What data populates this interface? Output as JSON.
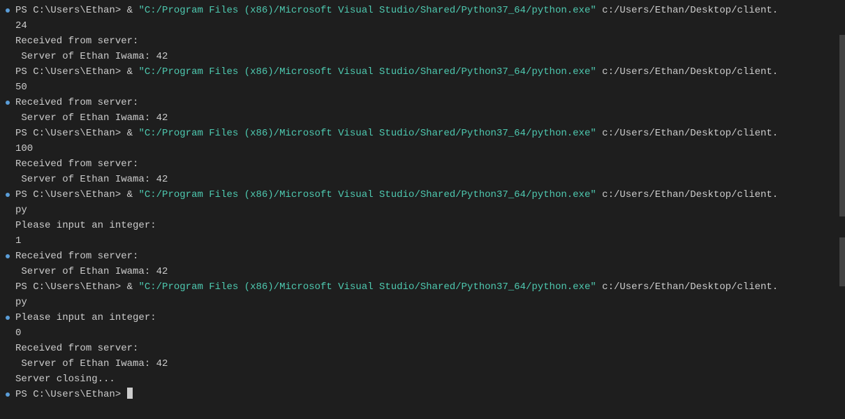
{
  "prompt": "PS C:\\Users\\Ethan>",
  "amp": "&",
  "exe_path": "\"C:/Program Files (x86)/Microsoft Visual Studio/Shared/Python37_64/python.exe\"",
  "client_path": "c:/Users/Ethan/Desktop/client.",
  "py_suffix": "py",
  "received": "Received from server:",
  "server_response": " Server of Ethan Iwama: 42",
  "input_prompt": "Please input an integer:",
  "server_closing": "Server closing...",
  "vals": {
    "v24": "24",
    "v50": "50",
    "v100": "100",
    "v1": "1",
    "v0": "0"
  }
}
